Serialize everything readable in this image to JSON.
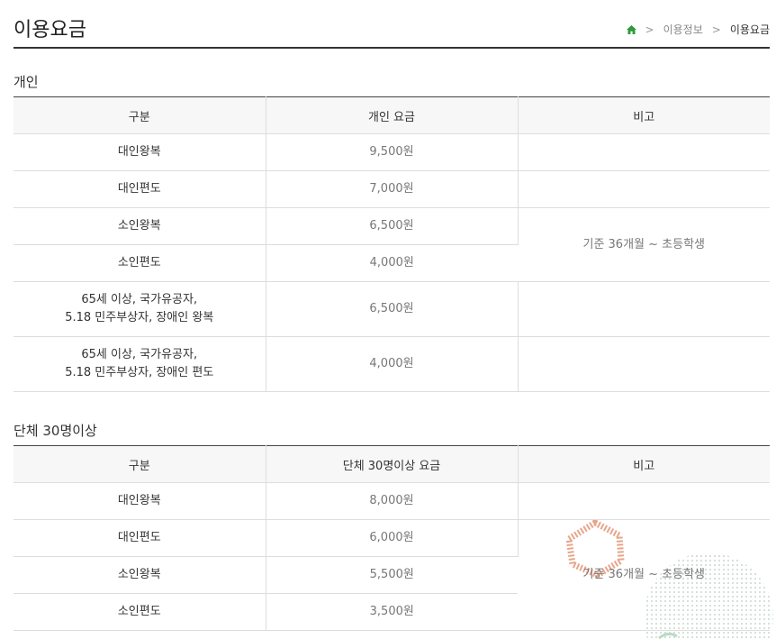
{
  "header": {
    "title": "이용요금",
    "breadcrumb": [
      "이용정보",
      "이용요금"
    ]
  },
  "individual": {
    "title": "개인",
    "columns": [
      "구분",
      "개인 요금",
      "비고"
    ],
    "rows": [
      {
        "label": "대인왕복",
        "price": "9,500원"
      },
      {
        "label": "대인편도",
        "price": "7,000원"
      },
      {
        "label": "소인왕복",
        "price": "6,500원"
      },
      {
        "label": "소인편도",
        "price": "4,000원"
      },
      {
        "label_line1": "65세 이상, 국가유공자,",
        "label_line2": "5.18 민주부상자, 장애인 왕복",
        "price": "6,500원"
      },
      {
        "label_line1": "65세 이상, 국가유공자,",
        "label_line2": "5.18 민주부상자, 장애인 편도",
        "price": "4,000원"
      }
    ],
    "note": "기준 36개월 ~ 초등학생"
  },
  "group": {
    "title": "단체 30명이상",
    "columns": [
      "구분",
      "단체 30명이상 요금",
      "비고"
    ],
    "rows": [
      {
        "label": "대인왕복",
        "price": "8,000원"
      },
      {
        "label": "대인편도",
        "price": "6,000원"
      },
      {
        "label": "소인왕복",
        "price": "5,500원"
      },
      {
        "label": "소인편도",
        "price": "3,500원"
      }
    ],
    "note": "기준 36개월 ~ 초등학생"
  },
  "icons": {
    "home": "home-icon",
    "separator": "chevron-right-icon"
  },
  "colors": {
    "home_icon": "#2e9a3c",
    "deco_orange": "#e8a58a",
    "deco_green": "#b9dcc4"
  }
}
